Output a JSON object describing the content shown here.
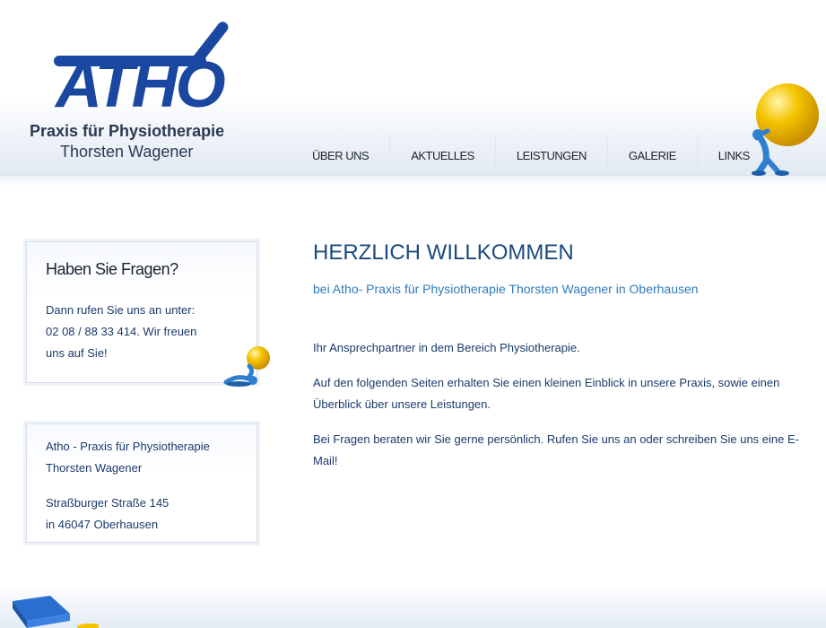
{
  "brand": {
    "logo_word": "ATHO",
    "line1": "Praxis für Physiotherapie",
    "line2": "Thorsten Wagener",
    "color": "#1a47a0"
  },
  "nav": {
    "items": [
      {
        "label": "ÜBER UNS"
      },
      {
        "label": "AKTUELLES"
      },
      {
        "label": "LEISTUNGEN"
      },
      {
        "label": "GALERIE"
      },
      {
        "label": "LINKS"
      }
    ]
  },
  "sidebar": {
    "contact_box": {
      "title": "Haben Sie Fragen?",
      "line1": "Dann rufen Sie uns an unter:",
      "line2": "02 08 / 88 33 414. Wir freuen",
      "line3": "uns auf Sie!"
    },
    "address_box": {
      "line1": "Atho - Praxis für Physiotherapie",
      "line2": "Thorsten Wagener",
      "line3": "Straßburger Straße 145",
      "line4": "in 46047 Oberhausen"
    }
  },
  "main": {
    "title": "HERZLICH WILLKOMMEN",
    "subtitle": "bei Atho- Praxis für Physiotherapie Thorsten Wagener in Oberhausen",
    "paragraphs": [
      "Ihr Ansprechpartner in dem Bereich Physiotherapie.",
      "Auf den folgenden Seiten erhalten Sie einen kleinen Einblick in unsere Praxis, sowie einen Überblick über unsere Leistungen.",
      "Bei Fragen beraten wir Sie gerne persönlich. Rufen Sie uns an oder schreiben Sie uns eine E-Mail!"
    ]
  },
  "colors": {
    "title": "#1b4a7d",
    "subtitle": "#2d7bbf",
    "body_text": "#1b3a6b",
    "ball": "#f5c400",
    "mascot": "#2f7fd0"
  },
  "icons": {
    "mascot_top": "mascot-ball-icon",
    "mascot_small": "mascot-lying-ball-icon",
    "book": "book-icon"
  }
}
